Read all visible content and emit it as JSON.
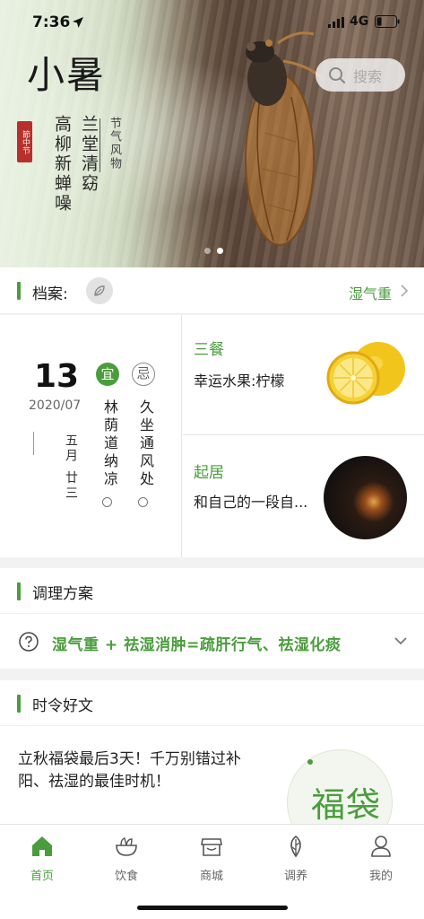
{
  "status_bar": {
    "time": "7:36",
    "network": "4G"
  },
  "search": {
    "placeholder": "搜索"
  },
  "hero": {
    "term": "小暑",
    "seal": "節中节",
    "line1": "高柳新蝉噪",
    "line2": "兰堂清窈",
    "subtitle": "节气风物",
    "slide_count": 2,
    "active_slide": 1
  },
  "archive": {
    "label": "档案:",
    "status": "湿气重"
  },
  "calendar": {
    "day": "13",
    "year_month": "2020/07",
    "lunar": "五月 廿三",
    "yi_badge": "宜",
    "ji_badge": "忌",
    "yi_text": "林荫道纳凉",
    "ji_text": "久坐通风处"
  },
  "cards": [
    {
      "category": "三餐",
      "desc": "幸运水果:柠檬"
    },
    {
      "category": "起居",
      "desc": "和自己的一段自..."
    }
  ],
  "plan": {
    "title": "调理方案",
    "formula": "湿气重 + 祛湿消肿=疏肝行气、祛湿化痰"
  },
  "articles": {
    "title": "时令好文",
    "text": "立秋福袋最后3天！千万别错过补阳、祛湿的最佳时机！",
    "badge": "福袋"
  },
  "tabbar": [
    {
      "label": "首页",
      "icon": "home-icon",
      "active": true
    },
    {
      "label": "饮食",
      "icon": "food-bowl-icon",
      "active": false
    },
    {
      "label": "商城",
      "icon": "store-icon",
      "active": false
    },
    {
      "label": "调养",
      "icon": "leaf-icon",
      "active": false
    },
    {
      "label": "我的",
      "icon": "user-icon",
      "active": false
    }
  ],
  "colors": {
    "accent": "#4a9d3c",
    "text": "#222222",
    "muted": "#666666",
    "background": "#f2f2f2"
  }
}
